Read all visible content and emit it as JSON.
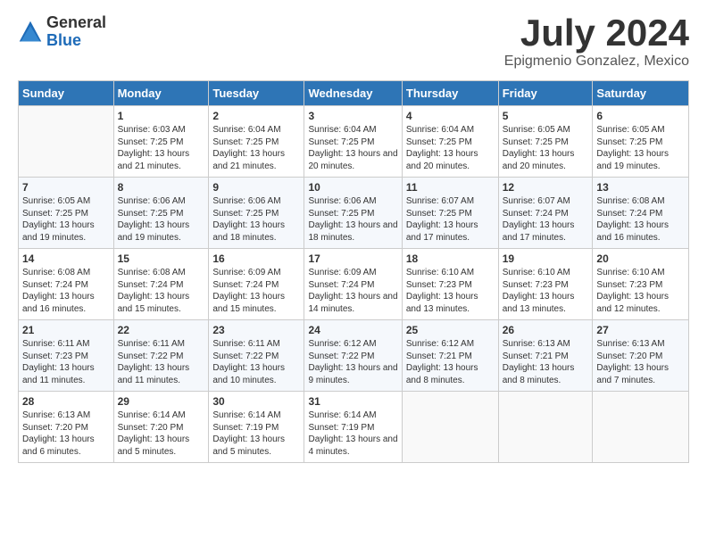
{
  "header": {
    "logo_general": "General",
    "logo_blue": "Blue",
    "month_title": "July 2024",
    "subtitle": "Epigmenio Gonzalez, Mexico"
  },
  "days_of_week": [
    "Sunday",
    "Monday",
    "Tuesday",
    "Wednesday",
    "Thursday",
    "Friday",
    "Saturday"
  ],
  "weeks": [
    [
      {
        "day": "",
        "sunrise": "",
        "sunset": "",
        "daylight": ""
      },
      {
        "day": "1",
        "sunrise": "Sunrise: 6:03 AM",
        "sunset": "Sunset: 7:25 PM",
        "daylight": "Daylight: 13 hours and 21 minutes."
      },
      {
        "day": "2",
        "sunrise": "Sunrise: 6:04 AM",
        "sunset": "Sunset: 7:25 PM",
        "daylight": "Daylight: 13 hours and 21 minutes."
      },
      {
        "day": "3",
        "sunrise": "Sunrise: 6:04 AM",
        "sunset": "Sunset: 7:25 PM",
        "daylight": "Daylight: 13 hours and 20 minutes."
      },
      {
        "day": "4",
        "sunrise": "Sunrise: 6:04 AM",
        "sunset": "Sunset: 7:25 PM",
        "daylight": "Daylight: 13 hours and 20 minutes."
      },
      {
        "day": "5",
        "sunrise": "Sunrise: 6:05 AM",
        "sunset": "Sunset: 7:25 PM",
        "daylight": "Daylight: 13 hours and 20 minutes."
      },
      {
        "day": "6",
        "sunrise": "Sunrise: 6:05 AM",
        "sunset": "Sunset: 7:25 PM",
        "daylight": "Daylight: 13 hours and 19 minutes."
      }
    ],
    [
      {
        "day": "7",
        "sunrise": "Sunrise: 6:05 AM",
        "sunset": "Sunset: 7:25 PM",
        "daylight": "Daylight: 13 hours and 19 minutes."
      },
      {
        "day": "8",
        "sunrise": "Sunrise: 6:06 AM",
        "sunset": "Sunset: 7:25 PM",
        "daylight": "Daylight: 13 hours and 19 minutes."
      },
      {
        "day": "9",
        "sunrise": "Sunrise: 6:06 AM",
        "sunset": "Sunset: 7:25 PM",
        "daylight": "Daylight: 13 hours and 18 minutes."
      },
      {
        "day": "10",
        "sunrise": "Sunrise: 6:06 AM",
        "sunset": "Sunset: 7:25 PM",
        "daylight": "Daylight: 13 hours and 18 minutes."
      },
      {
        "day": "11",
        "sunrise": "Sunrise: 6:07 AM",
        "sunset": "Sunset: 7:25 PM",
        "daylight": "Daylight: 13 hours and 17 minutes."
      },
      {
        "day": "12",
        "sunrise": "Sunrise: 6:07 AM",
        "sunset": "Sunset: 7:24 PM",
        "daylight": "Daylight: 13 hours and 17 minutes."
      },
      {
        "day": "13",
        "sunrise": "Sunrise: 6:08 AM",
        "sunset": "Sunset: 7:24 PM",
        "daylight": "Daylight: 13 hours and 16 minutes."
      }
    ],
    [
      {
        "day": "14",
        "sunrise": "Sunrise: 6:08 AM",
        "sunset": "Sunset: 7:24 PM",
        "daylight": "Daylight: 13 hours and 16 minutes."
      },
      {
        "day": "15",
        "sunrise": "Sunrise: 6:08 AM",
        "sunset": "Sunset: 7:24 PM",
        "daylight": "Daylight: 13 hours and 15 minutes."
      },
      {
        "day": "16",
        "sunrise": "Sunrise: 6:09 AM",
        "sunset": "Sunset: 7:24 PM",
        "daylight": "Daylight: 13 hours and 15 minutes."
      },
      {
        "day": "17",
        "sunrise": "Sunrise: 6:09 AM",
        "sunset": "Sunset: 7:24 PM",
        "daylight": "Daylight: 13 hours and 14 minutes."
      },
      {
        "day": "18",
        "sunrise": "Sunrise: 6:10 AM",
        "sunset": "Sunset: 7:23 PM",
        "daylight": "Daylight: 13 hours and 13 minutes."
      },
      {
        "day": "19",
        "sunrise": "Sunrise: 6:10 AM",
        "sunset": "Sunset: 7:23 PM",
        "daylight": "Daylight: 13 hours and 13 minutes."
      },
      {
        "day": "20",
        "sunrise": "Sunrise: 6:10 AM",
        "sunset": "Sunset: 7:23 PM",
        "daylight": "Daylight: 13 hours and 12 minutes."
      }
    ],
    [
      {
        "day": "21",
        "sunrise": "Sunrise: 6:11 AM",
        "sunset": "Sunset: 7:23 PM",
        "daylight": "Daylight: 13 hours and 11 minutes."
      },
      {
        "day": "22",
        "sunrise": "Sunrise: 6:11 AM",
        "sunset": "Sunset: 7:22 PM",
        "daylight": "Daylight: 13 hours and 11 minutes."
      },
      {
        "day": "23",
        "sunrise": "Sunrise: 6:11 AM",
        "sunset": "Sunset: 7:22 PM",
        "daylight": "Daylight: 13 hours and 10 minutes."
      },
      {
        "day": "24",
        "sunrise": "Sunrise: 6:12 AM",
        "sunset": "Sunset: 7:22 PM",
        "daylight": "Daylight: 13 hours and 9 minutes."
      },
      {
        "day": "25",
        "sunrise": "Sunrise: 6:12 AM",
        "sunset": "Sunset: 7:21 PM",
        "daylight": "Daylight: 13 hours and 8 minutes."
      },
      {
        "day": "26",
        "sunrise": "Sunrise: 6:13 AM",
        "sunset": "Sunset: 7:21 PM",
        "daylight": "Daylight: 13 hours and 8 minutes."
      },
      {
        "day": "27",
        "sunrise": "Sunrise: 6:13 AM",
        "sunset": "Sunset: 7:20 PM",
        "daylight": "Daylight: 13 hours and 7 minutes."
      }
    ],
    [
      {
        "day": "28",
        "sunrise": "Sunrise: 6:13 AM",
        "sunset": "Sunset: 7:20 PM",
        "daylight": "Daylight: 13 hours and 6 minutes."
      },
      {
        "day": "29",
        "sunrise": "Sunrise: 6:14 AM",
        "sunset": "Sunset: 7:20 PM",
        "daylight": "Daylight: 13 hours and 5 minutes."
      },
      {
        "day": "30",
        "sunrise": "Sunrise: 6:14 AM",
        "sunset": "Sunset: 7:19 PM",
        "daylight": "Daylight: 13 hours and 5 minutes."
      },
      {
        "day": "31",
        "sunrise": "Sunrise: 6:14 AM",
        "sunset": "Sunset: 7:19 PM",
        "daylight": "Daylight: 13 hours and 4 minutes."
      },
      {
        "day": "",
        "sunrise": "",
        "sunset": "",
        "daylight": ""
      },
      {
        "day": "",
        "sunrise": "",
        "sunset": "",
        "daylight": ""
      },
      {
        "day": "",
        "sunrise": "",
        "sunset": "",
        "daylight": ""
      }
    ]
  ]
}
